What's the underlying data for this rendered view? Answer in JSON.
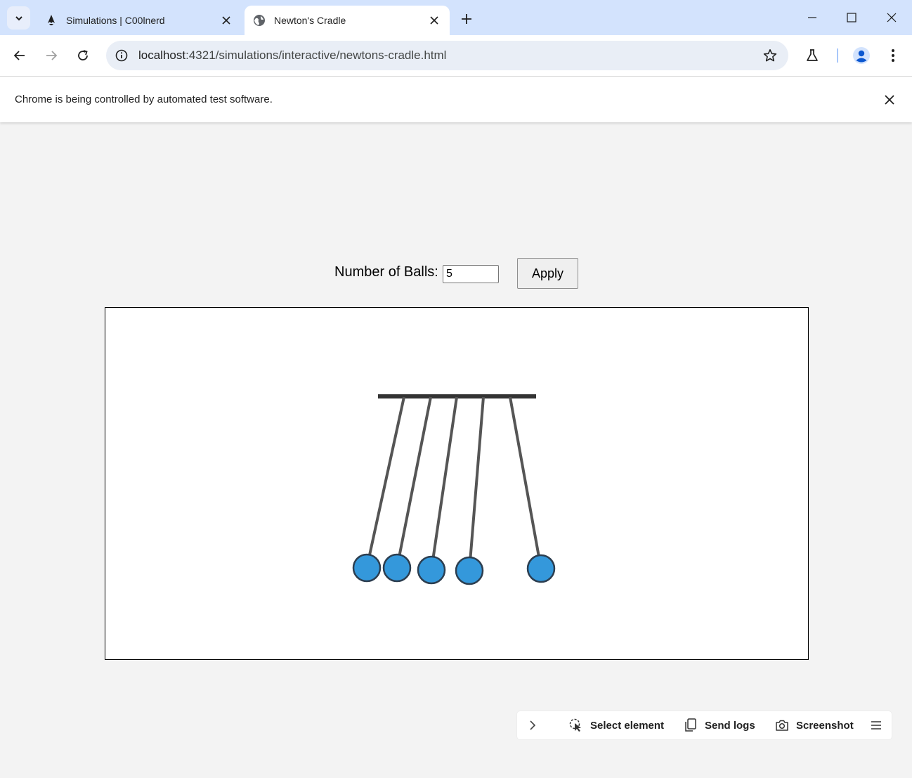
{
  "browser": {
    "tabs": [
      {
        "title": "Simulations | C00lnerd",
        "active": false,
        "icon": "astro-logo-icon"
      },
      {
        "title": "Newton's Cradle",
        "active": true,
        "icon": "globe-icon"
      }
    ],
    "url": {
      "host": "localhost",
      "path": ":4321/simulations/interactive/newtons-cradle.html"
    },
    "infobar_message": "Chrome is being controlled by automated test software."
  },
  "page": {
    "controls": {
      "balls_label": "Number of Balls:",
      "balls_value": "5",
      "apply_label": "Apply"
    }
  },
  "simulation": {
    "ball_count": 5,
    "ball_color": "#3498db",
    "string_color": "#555555",
    "bar_color": "#333333"
  },
  "helper_bar": {
    "select_element": "Select element",
    "send_logs": "Send logs",
    "screenshot": "Screenshot"
  },
  "colors": {
    "tabstrip": "#d3e3fd",
    "page_background": "#f3f3f3"
  }
}
